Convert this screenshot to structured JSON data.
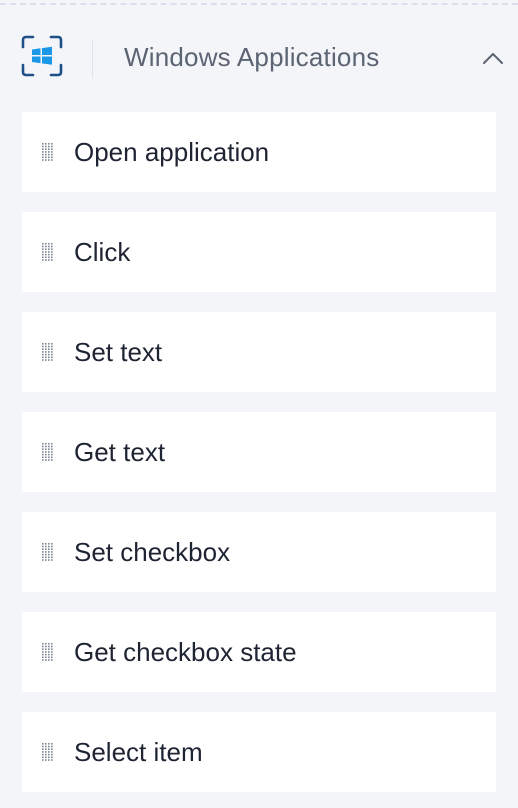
{
  "section": {
    "title": "Windows Applications",
    "icon": "windows-app-icon",
    "collapse_icon": "chevron-up-icon",
    "accent_color": "#1a97e6",
    "frame_color": "#1e4f86"
  },
  "actions": [
    {
      "label": "Open application",
      "icon": "drag-handle-icon"
    },
    {
      "label": "Click",
      "icon": "drag-handle-icon"
    },
    {
      "label": "Set text",
      "icon": "drag-handle-icon"
    },
    {
      "label": "Get text",
      "icon": "drag-handle-icon"
    },
    {
      "label": "Set checkbox",
      "icon": "drag-handle-icon"
    },
    {
      "label": "Get checkbox state",
      "icon": "drag-handle-icon"
    },
    {
      "label": "Select item",
      "icon": "drag-handle-icon"
    }
  ]
}
